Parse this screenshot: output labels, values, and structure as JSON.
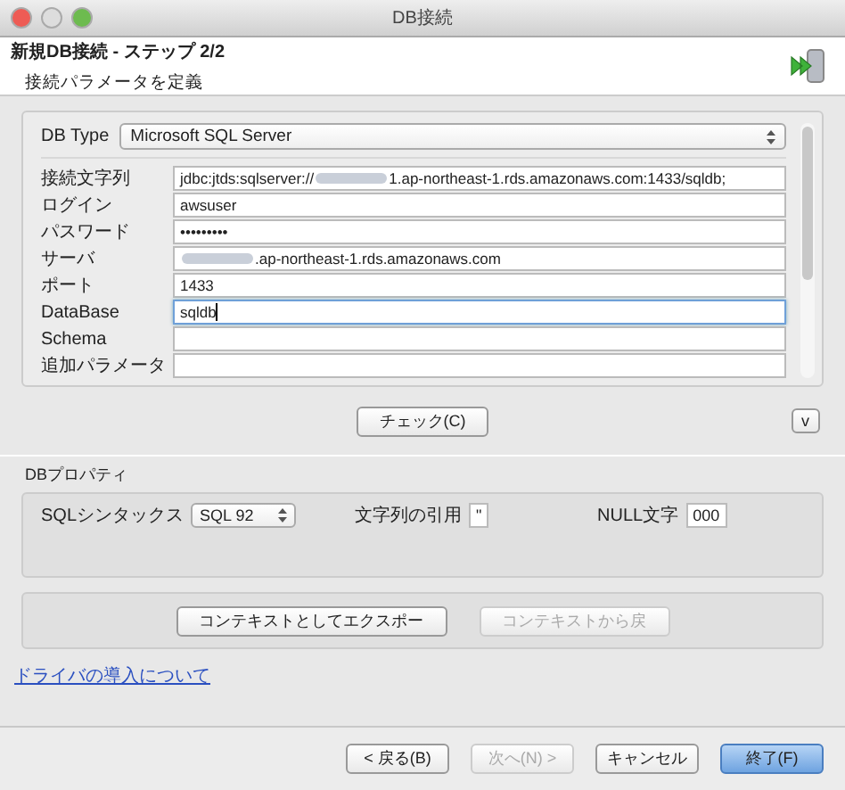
{
  "window": {
    "title": "DB接続"
  },
  "header": {
    "title": "新規DB接続 - ステップ 2/2",
    "subtitle": "接続パラメータを定義"
  },
  "db_type": {
    "label": "DB Type",
    "value": "Microsoft SQL Server"
  },
  "fields": [
    {
      "label": "接続文字列",
      "prefix": "jdbc:jtds:sqlserver://",
      "redacted": true,
      "value": "1.ap-northeast-1.rds.amazonaws.com:1433/sqldb;",
      "focused": false
    },
    {
      "label": "ログイン",
      "redacted": false,
      "value": "awsuser",
      "focused": false
    },
    {
      "label": "パスワード",
      "redacted": false,
      "value": "•••••••••",
      "focused": false
    },
    {
      "label": "サーバ",
      "redacted": true,
      "value": ".ap-northeast-1.rds.amazonaws.com",
      "focused": false
    },
    {
      "label": "ポート",
      "redacted": false,
      "value": "1433",
      "focused": false
    },
    {
      "label": "DataBase",
      "redacted": false,
      "value": "sqldb",
      "focused": true
    },
    {
      "label": "Schema",
      "redacted": false,
      "focused": false
    },
    {
      "label": "追加パラメータ",
      "redacted": false,
      "focused": false
    }
  ],
  "check_button": {
    "label": "チェック(C)"
  },
  "expand_button": {
    "label": "v"
  },
  "db_properties": {
    "title": "DBプロパティ",
    "syntax_label": "SQLシンタックス",
    "syntax_value": "SQL 92",
    "quote_label": "文字列の引用",
    "quote_value": "\"",
    "null_label": "NULL文字",
    "null_value": "000"
  },
  "context_buttons": [
    {
      "label": "コンテキストとしてエクスポー",
      "disabled": false
    },
    {
      "label": "コンテキストから戻",
      "disabled": true
    }
  ],
  "driver_link": "ドライバの導入について",
  "footer_buttons": [
    {
      "label": "< 戻る(B)",
      "disabled": false,
      "default": false
    },
    {
      "label": "次へ(N) >",
      "disabled": true,
      "default": false
    },
    {
      "label": "キャンセル",
      "disabled": false,
      "default": false
    },
    {
      "label": "終了(F)",
      "disabled": false,
      "default": true
    }
  ]
}
